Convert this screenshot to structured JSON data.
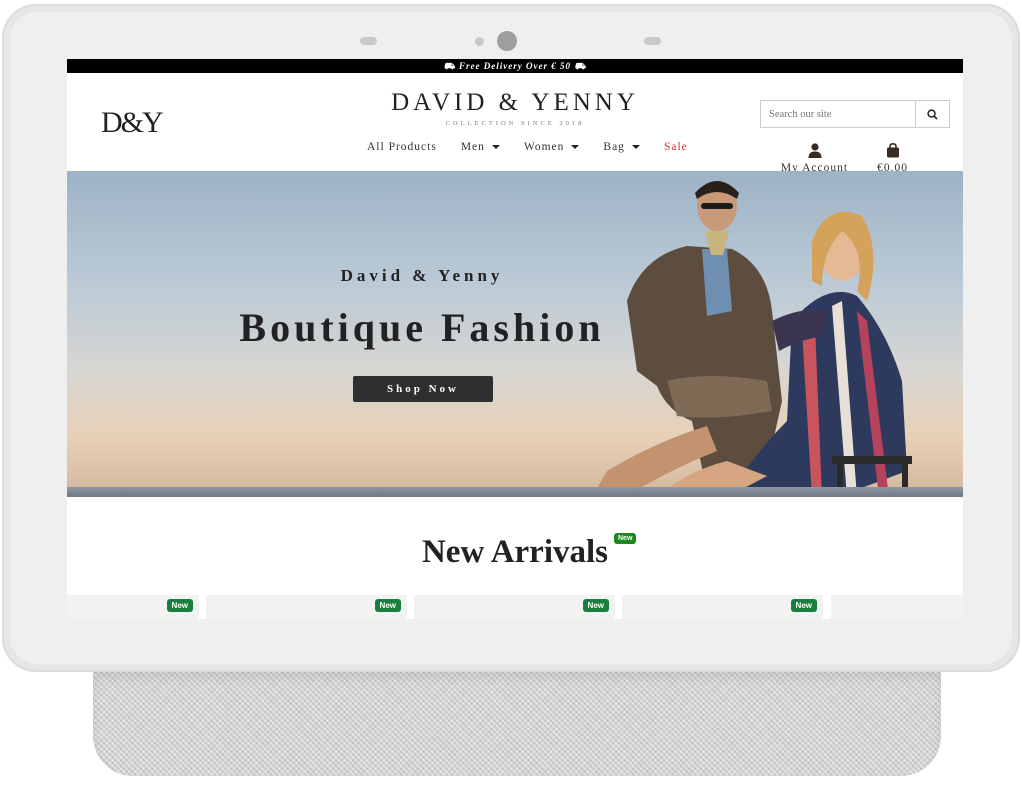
{
  "announcement": "⛟ Free Delivery Over € 50 ⛟",
  "header": {
    "logo": "D&Y",
    "brand": "DAVID & YENNY",
    "tagline": "COLLECTION SINCE 2018",
    "search_placeholder": "Search our site",
    "account_label": "My Account",
    "cart_total": "€0.00"
  },
  "nav": [
    {
      "label": "All Products",
      "dropdown": false
    },
    {
      "label": "Men",
      "dropdown": true
    },
    {
      "label": "Women",
      "dropdown": true
    },
    {
      "label": "Bag",
      "dropdown": true
    },
    {
      "label": "Sale",
      "dropdown": false,
      "highlight": "#d32f2f"
    }
  ],
  "hero": {
    "subtitle": "David & Yenny",
    "title": "Boutique Fashion",
    "cta": "Shop Now"
  },
  "arrivals": {
    "heading": "New Arrivals",
    "heading_badge": "New",
    "card_badges": [
      "New",
      "New",
      "New",
      "New"
    ]
  },
  "colors": {
    "badge_green": "#1a7f3c",
    "sale_red": "#d32f2f",
    "button_dark": "#2f2f2f"
  }
}
